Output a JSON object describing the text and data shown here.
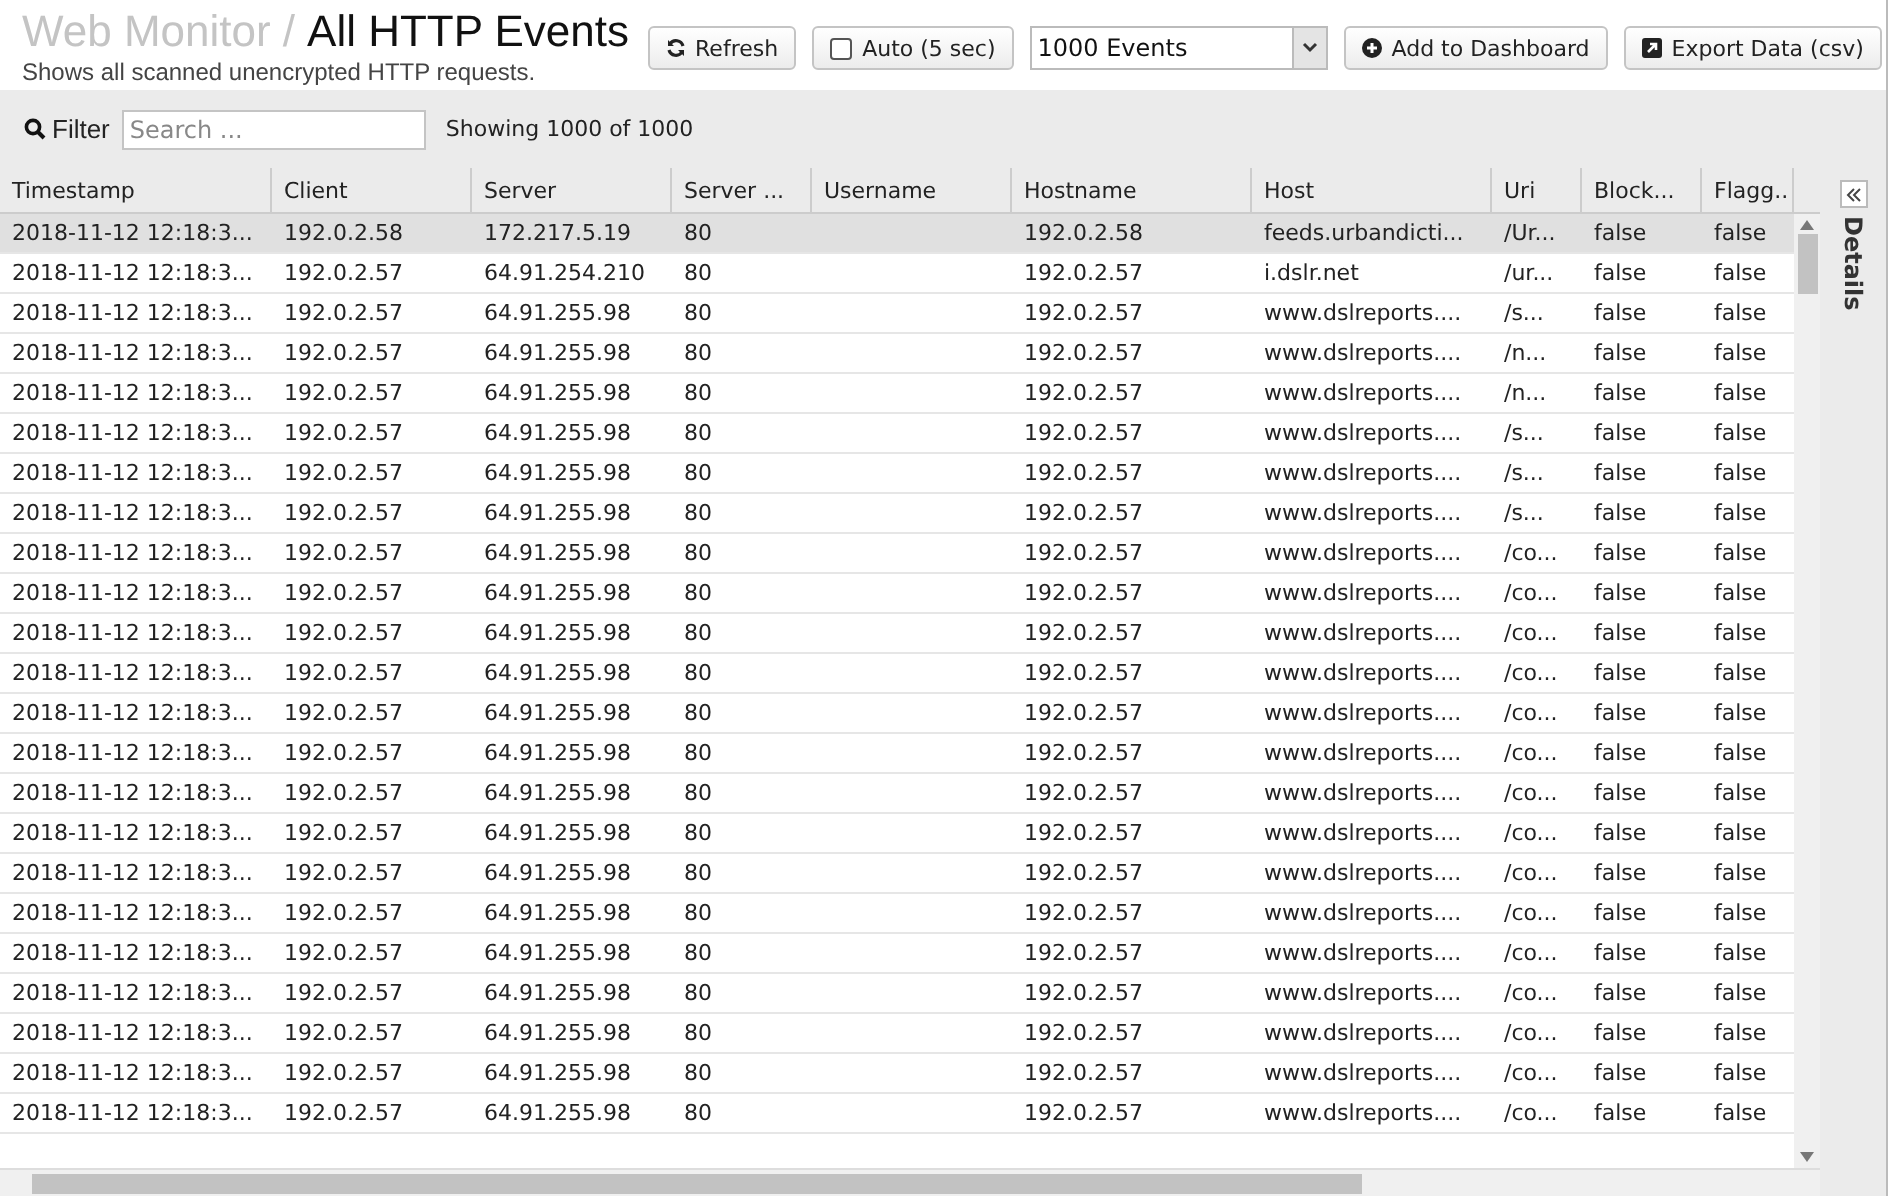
{
  "header": {
    "breadcrumb": "Web Monitor /",
    "title": "All HTTP Events",
    "subtitle": "Shows all scanned unencrypted HTTP requests."
  },
  "toolbar": {
    "refresh": "Refresh",
    "auto": {
      "label": "Auto (5 sec)",
      "checked": false
    },
    "events_select": "1000 Events",
    "add_dashboard": "Add to Dashboard",
    "export": "Export Data (csv)"
  },
  "filter": {
    "label": "Filter",
    "placeholder": "Search ...",
    "count": "Showing 1000 of 1000"
  },
  "table": {
    "columns": [
      "Timestamp",
      "Client",
      "Server",
      "Server ...",
      "Username",
      "Hostname",
      "Host",
      "Uri",
      "Block...",
      "Flagg.."
    ],
    "rows": [
      {
        "selected": true,
        "cells": [
          "2018-11-12 12:18:3...",
          "192.0.2.58",
          "172.217.5.19",
          "80",
          "",
          "192.0.2.58",
          "feeds.urbandicti...",
          "/Ur...",
          "false",
          "false"
        ]
      },
      {
        "selected": false,
        "cells": [
          "2018-11-12 12:18:3...",
          "192.0.2.57",
          "64.91.254.210",
          "80",
          "",
          "192.0.2.57",
          "i.dslr.net",
          "/ur...",
          "false",
          "false"
        ]
      },
      {
        "selected": false,
        "cells": [
          "2018-11-12 12:18:3...",
          "192.0.2.57",
          "64.91.255.98",
          "80",
          "",
          "192.0.2.57",
          "www.dslreports....",
          "/s...",
          "false",
          "false"
        ]
      },
      {
        "selected": false,
        "cells": [
          "2018-11-12 12:18:3...",
          "192.0.2.57",
          "64.91.255.98",
          "80",
          "",
          "192.0.2.57",
          "www.dslreports....",
          "/n...",
          "false",
          "false"
        ]
      },
      {
        "selected": false,
        "cells": [
          "2018-11-12 12:18:3...",
          "192.0.2.57",
          "64.91.255.98",
          "80",
          "",
          "192.0.2.57",
          "www.dslreports....",
          "/n...",
          "false",
          "false"
        ]
      },
      {
        "selected": false,
        "cells": [
          "2018-11-12 12:18:3...",
          "192.0.2.57",
          "64.91.255.98",
          "80",
          "",
          "192.0.2.57",
          "www.dslreports....",
          "/s...",
          "false",
          "false"
        ]
      },
      {
        "selected": false,
        "cells": [
          "2018-11-12 12:18:3...",
          "192.0.2.57",
          "64.91.255.98",
          "80",
          "",
          "192.0.2.57",
          "www.dslreports....",
          "/s...",
          "false",
          "false"
        ]
      },
      {
        "selected": false,
        "cells": [
          "2018-11-12 12:18:3...",
          "192.0.2.57",
          "64.91.255.98",
          "80",
          "",
          "192.0.2.57",
          "www.dslreports....",
          "/s...",
          "false",
          "false"
        ]
      },
      {
        "selected": false,
        "cells": [
          "2018-11-12 12:18:3...",
          "192.0.2.57",
          "64.91.255.98",
          "80",
          "",
          "192.0.2.57",
          "www.dslreports....",
          "/co...",
          "false",
          "false"
        ]
      },
      {
        "selected": false,
        "cells": [
          "2018-11-12 12:18:3...",
          "192.0.2.57",
          "64.91.255.98",
          "80",
          "",
          "192.0.2.57",
          "www.dslreports....",
          "/co...",
          "false",
          "false"
        ]
      },
      {
        "selected": false,
        "cells": [
          "2018-11-12 12:18:3...",
          "192.0.2.57",
          "64.91.255.98",
          "80",
          "",
          "192.0.2.57",
          "www.dslreports....",
          "/co...",
          "false",
          "false"
        ]
      },
      {
        "selected": false,
        "cells": [
          "2018-11-12 12:18:3...",
          "192.0.2.57",
          "64.91.255.98",
          "80",
          "",
          "192.0.2.57",
          "www.dslreports....",
          "/co...",
          "false",
          "false"
        ]
      },
      {
        "selected": false,
        "cells": [
          "2018-11-12 12:18:3...",
          "192.0.2.57",
          "64.91.255.98",
          "80",
          "",
          "192.0.2.57",
          "www.dslreports....",
          "/co...",
          "false",
          "false"
        ]
      },
      {
        "selected": false,
        "cells": [
          "2018-11-12 12:18:3...",
          "192.0.2.57",
          "64.91.255.98",
          "80",
          "",
          "192.0.2.57",
          "www.dslreports....",
          "/co...",
          "false",
          "false"
        ]
      },
      {
        "selected": false,
        "cells": [
          "2018-11-12 12:18:3...",
          "192.0.2.57",
          "64.91.255.98",
          "80",
          "",
          "192.0.2.57",
          "www.dslreports....",
          "/co...",
          "false",
          "false"
        ]
      },
      {
        "selected": false,
        "cells": [
          "2018-11-12 12:18:3...",
          "192.0.2.57",
          "64.91.255.98",
          "80",
          "",
          "192.0.2.57",
          "www.dslreports....",
          "/co...",
          "false",
          "false"
        ]
      },
      {
        "selected": false,
        "cells": [
          "2018-11-12 12:18:3...",
          "192.0.2.57",
          "64.91.255.98",
          "80",
          "",
          "192.0.2.57",
          "www.dslreports....",
          "/co...",
          "false",
          "false"
        ]
      },
      {
        "selected": false,
        "cells": [
          "2018-11-12 12:18:3...",
          "192.0.2.57",
          "64.91.255.98",
          "80",
          "",
          "192.0.2.57",
          "www.dslreports....",
          "/co...",
          "false",
          "false"
        ]
      },
      {
        "selected": false,
        "cells": [
          "2018-11-12 12:18:3...",
          "192.0.2.57",
          "64.91.255.98",
          "80",
          "",
          "192.0.2.57",
          "www.dslreports....",
          "/co...",
          "false",
          "false"
        ]
      },
      {
        "selected": false,
        "cells": [
          "2018-11-12 12:18:3...",
          "192.0.2.57",
          "64.91.255.98",
          "80",
          "",
          "192.0.2.57",
          "www.dslreports....",
          "/co...",
          "false",
          "false"
        ]
      },
      {
        "selected": false,
        "cells": [
          "2018-11-12 12:18:3...",
          "192.0.2.57",
          "64.91.255.98",
          "80",
          "",
          "192.0.2.57",
          "www.dslreports....",
          "/co...",
          "false",
          "false"
        ]
      },
      {
        "selected": false,
        "cells": [
          "2018-11-12 12:18:3...",
          "192.0.2.57",
          "64.91.255.98",
          "80",
          "",
          "192.0.2.57",
          "www.dslreports....",
          "/co...",
          "false",
          "false"
        ]
      },
      {
        "selected": false,
        "cells": [
          "2018-11-12 12:18:3...",
          "192.0.2.57",
          "64.91.255.98",
          "80",
          "",
          "192.0.2.57",
          "www.dslreports....",
          "/co...",
          "false",
          "false"
        ]
      }
    ]
  },
  "details_panel": {
    "label": "Details"
  }
}
